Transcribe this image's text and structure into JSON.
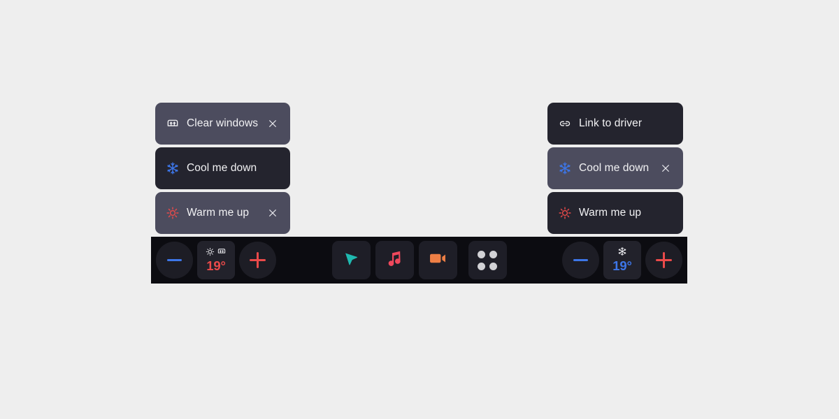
{
  "screen": {
    "background_color": "#eeeeee"
  },
  "left_panel": {
    "name": "passenger-climate-suggestions",
    "cards": [
      {
        "icon": "defrost-windshield-icon",
        "label": "Clear windows",
        "state": "highlight",
        "dismissible": true,
        "close_icon": "close-icon"
      },
      {
        "icon": "snowflake-icon",
        "label": "Cool me down",
        "state": "normal",
        "dismissible": false,
        "close_icon": "close-icon"
      },
      {
        "icon": "sun-icon",
        "label": "Warm me up",
        "state": "highlight",
        "dismissible": true,
        "close_icon": "close-icon"
      }
    ]
  },
  "right_panel": {
    "name": "driver-climate-suggestions",
    "cards": [
      {
        "icon": "link-icon",
        "label": "Link to driver",
        "state": "normal",
        "dismissible": false,
        "close_icon": "close-icon"
      },
      {
        "icon": "snowflake-icon",
        "label": "Cool me down",
        "state": "highlight",
        "dismissible": true,
        "close_icon": "close-icon"
      },
      {
        "icon": "sun-icon",
        "label": "Warm me up",
        "state": "normal",
        "dismissible": false,
        "close_icon": "close-icon"
      }
    ]
  },
  "toolbar": {
    "left_climate": {
      "decrease_icon": "minus-icon",
      "increase_icon": "plus-icon",
      "mode_icons": [
        "sun-icon",
        "defrost-windshield-icon"
      ],
      "temperature": "19°",
      "temp_tone": "warm"
    },
    "right_climate": {
      "decrease_icon": "minus-icon",
      "increase_icon": "plus-icon",
      "mode_icons": [
        "snowflake-icon"
      ],
      "temperature": "19°",
      "temp_tone": "cool"
    },
    "apps": [
      {
        "icon": "navigation-arrow-icon",
        "color": "#1fb9b0"
      },
      {
        "icon": "music-note-icon",
        "color": "#f0485c"
      },
      {
        "icon": "camera-video-icon",
        "color": "#ee7f45"
      }
    ],
    "app_launcher": {
      "icon": "app-grid-icon",
      "dot_color": "#d2d2d6"
    }
  },
  "colors": {
    "card_normal": "#24242e",
    "card_highlight": "#4c4c5e",
    "toolbar_bg": "#0c0c11",
    "tile_bg": "#1e1e27",
    "cool_accent": "#3d76e8",
    "warm_accent": "#ea4a4a",
    "snowflake_blue": "#3d76e8",
    "sun_red": "#ea4a4a"
  }
}
